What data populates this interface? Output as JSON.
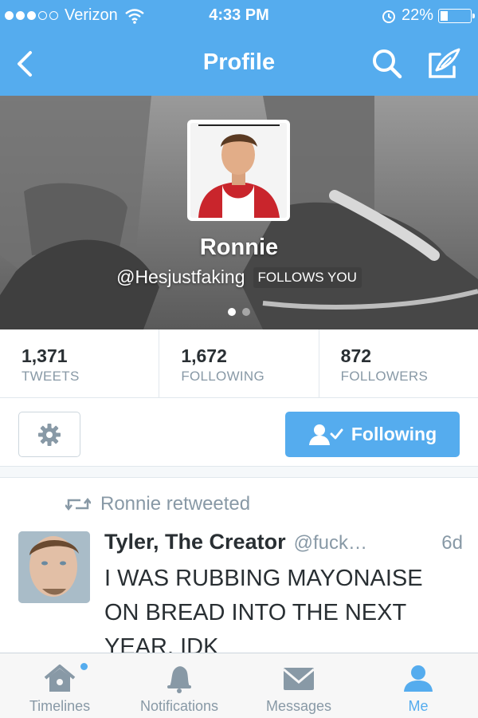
{
  "status_bar": {
    "carrier": "Verizon",
    "time": "4:33 PM",
    "battery_text": "22%",
    "battery_level": 0.22,
    "signal_bars_filled": 3,
    "signal_bars_total": 5
  },
  "nav": {
    "title": "Profile"
  },
  "profile": {
    "name": "Ronnie",
    "handle": "@Hesjustfaking",
    "follows_you": "FOLLOWS YOU",
    "page_dots": 2,
    "active_page": 1
  },
  "stats": [
    {
      "value": "1,371",
      "label": "TWEETS"
    },
    {
      "value": "1,672",
      "label": "FOLLOWING"
    },
    {
      "value": "872",
      "label": "FOLLOWERS"
    }
  ],
  "actions": {
    "following_label": "Following"
  },
  "tweet": {
    "retweet_label": "Ronnie retweeted",
    "author_name": "Tyler, The Creator",
    "author_handle": "@fuck…",
    "time": "6d",
    "text": "I WAS RUBBING MAYONAISE ON BREAD INTO THE NEXT YEAR. IDK"
  },
  "tabs": [
    {
      "label": "Timelines",
      "icon": "home-icon"
    },
    {
      "label": "Notifications",
      "icon": "bell-icon"
    },
    {
      "label": "Messages",
      "icon": "envelope-icon"
    },
    {
      "label": "Me",
      "icon": "person-icon",
      "active": true
    }
  ],
  "colors": {
    "brand_blue": "#55acee",
    "text_dark": "#292f33",
    "text_muted": "#8899a6",
    "border": "#e1e8ed"
  }
}
